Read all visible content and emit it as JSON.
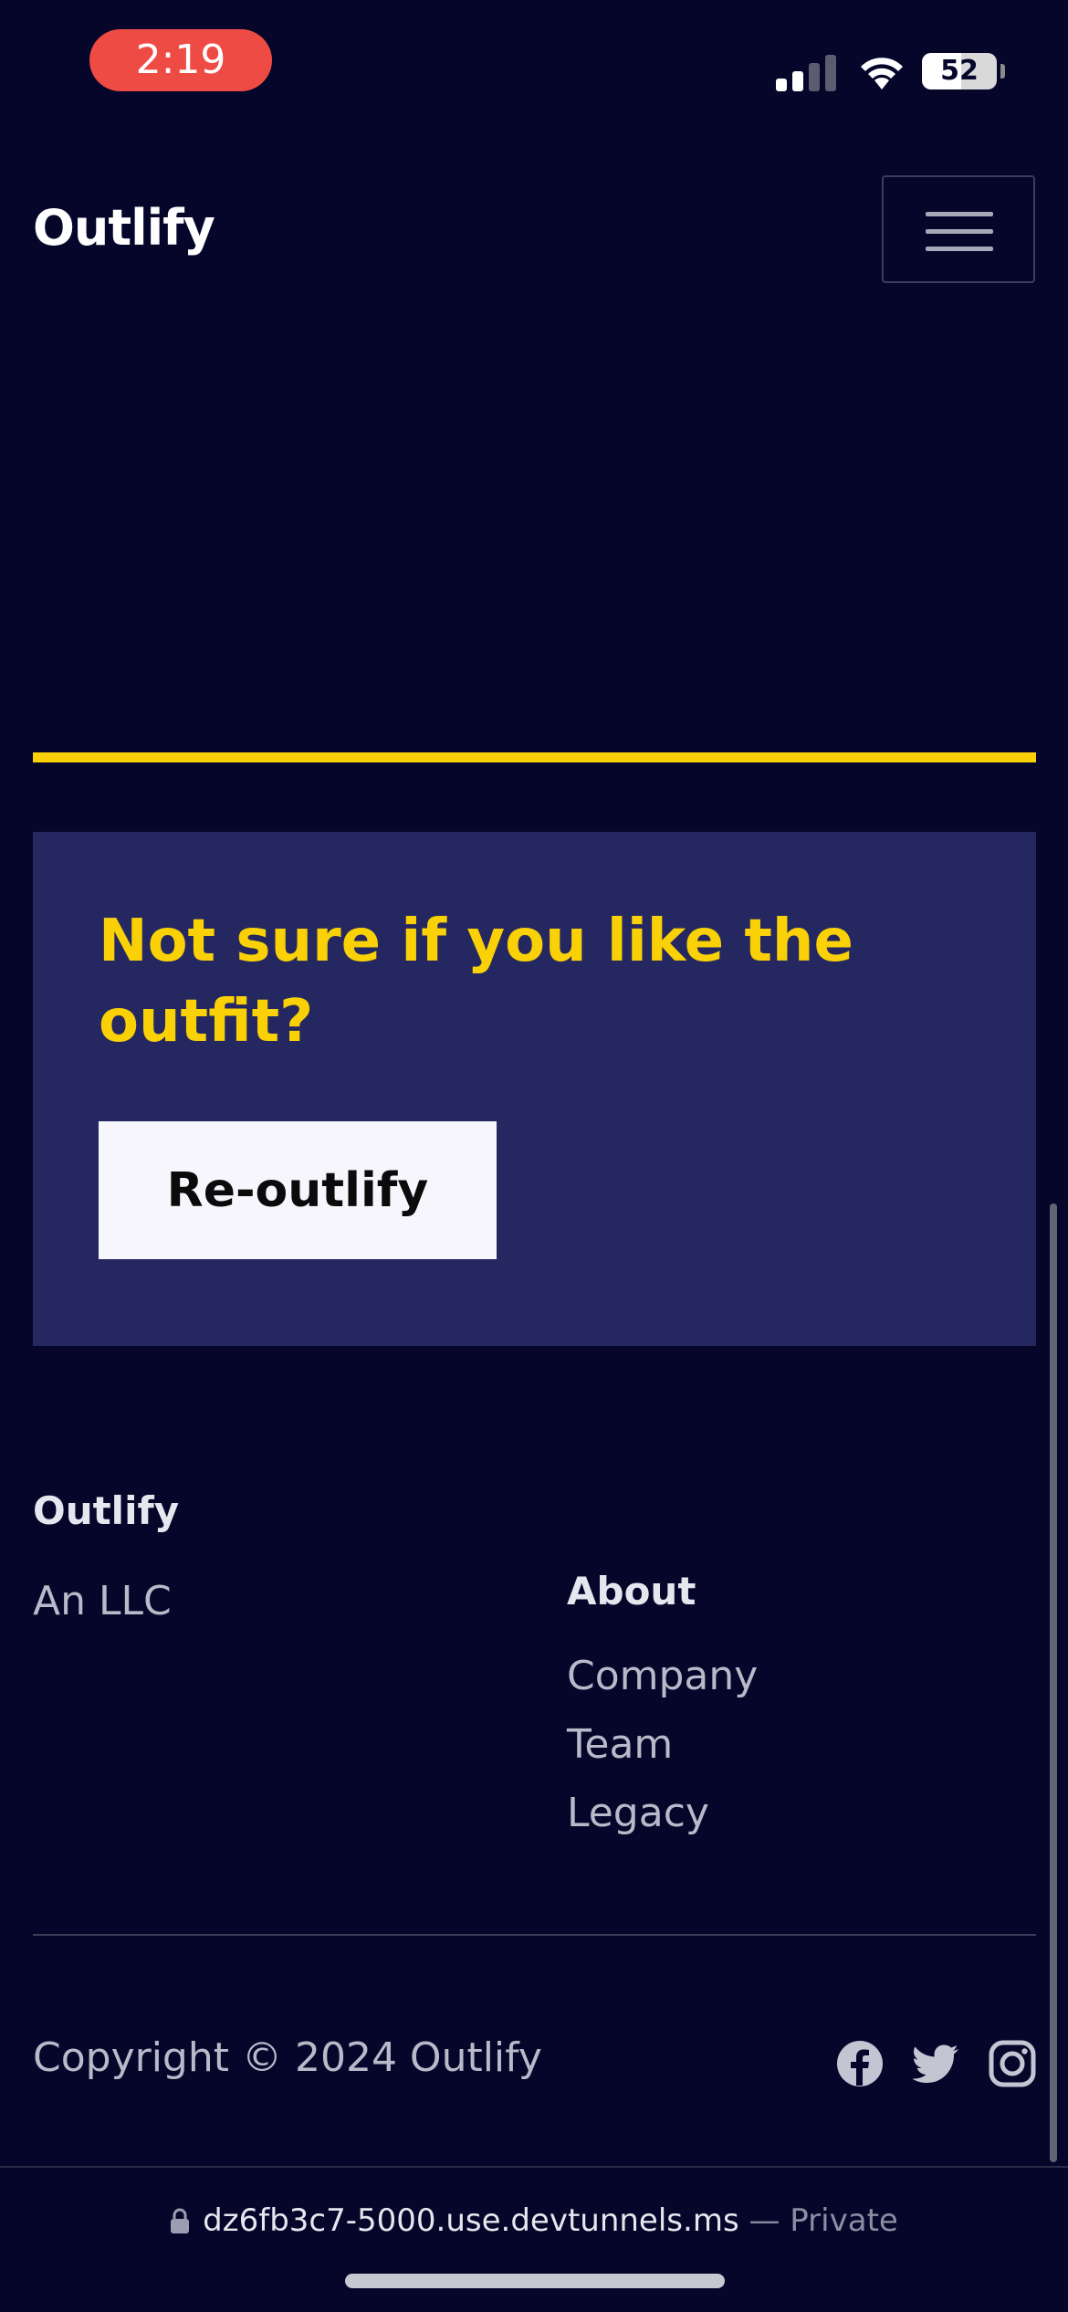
{
  "status_bar": {
    "time": "2:19",
    "battery_percent": "52",
    "battery_level": 0.52,
    "signal_bars_active": 2,
    "signal_bars_total": 4
  },
  "navbar": {
    "brand": "Outlify",
    "menu_icon": "hamburger-menu-icon"
  },
  "colors": {
    "background": "#05062a",
    "accent_yellow": "#f9d106",
    "card": "#252860",
    "button": "#f7f6fc"
  },
  "cta": {
    "title": "Not sure if you like the outfit?",
    "button_label": "Re-outlify"
  },
  "footer": {
    "brand": "Outlify",
    "tagline": "An LLC",
    "about": {
      "title": "About",
      "links": [
        "Company",
        "Team",
        "Legacy"
      ]
    },
    "copyright": "Copyright © 2024 Outlify",
    "social_icons": [
      "facebook-icon",
      "twitter-icon",
      "instagram-icon"
    ]
  },
  "browser": {
    "url": "dz6fb3c7-5000.use.devtunnels.ms",
    "separator": "—",
    "privacy": "Private"
  }
}
